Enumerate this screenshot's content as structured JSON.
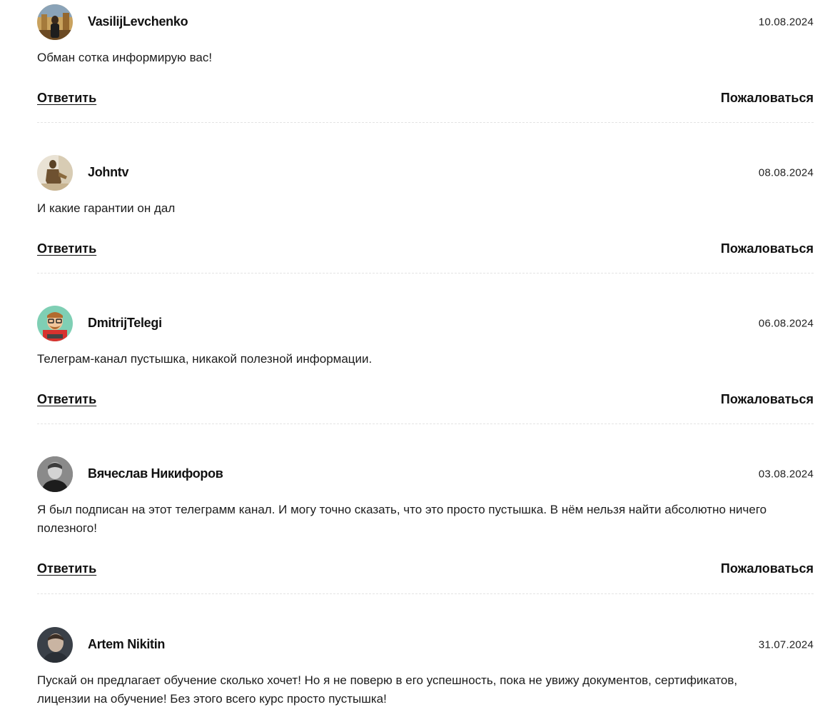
{
  "comments": [
    {
      "author": "VasilijLevchenko",
      "date": "10.08.2024",
      "text": "Обман сотка информирую вас!",
      "reply_label": "Ответить",
      "report_label": "Пожаловаться",
      "avatar_icon": "user-photo-avatar"
    },
    {
      "author": "Johntv",
      "date": "08.08.2024",
      "text": "И какие гарантии он дал",
      "reply_label": "Ответить",
      "report_label": "Пожаловаться",
      "avatar_icon": "user-photo-avatar"
    },
    {
      "author": "DmitrijTelegi",
      "date": "06.08.2024",
      "text": "Телеграм-канал пустышка, никакой полезной информации.",
      "reply_label": "Ответить",
      "report_label": "Пожаловаться",
      "avatar_icon": "cartoon-avatar"
    },
    {
      "author": "Вячеслав Никифоров",
      "date": "03.08.2024",
      "text": "Я был подписан на этот телеграмм канал. И могу точно сказать, что это просто пустышка. В нём нельзя найти абсолютно ничего полезного!",
      "reply_label": "Ответить",
      "report_label": "Пожаловаться",
      "avatar_icon": "user-photo-avatar"
    },
    {
      "author": "Artem Nikitin",
      "date": "31.07.2024",
      "text": "Пускай он предлагает обучение сколько хочет! Но я не поверю в его успешность, пока не увижу документов, сертификатов, лицензии на обучение! Без этого всего курс просто пустышка!",
      "avatar_icon": "user-photo-avatar"
    }
  ]
}
